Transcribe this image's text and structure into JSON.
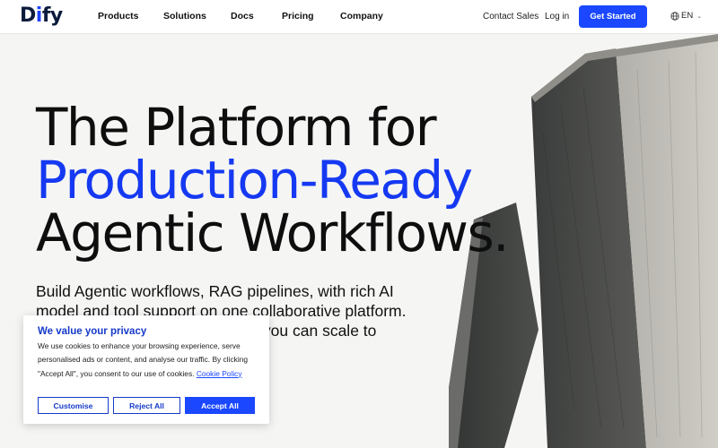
{
  "nav": {
    "logo_prefix": "D",
    "logo_mark": "i",
    "logo_suffix": "fy",
    "links": [
      "Products",
      "Solutions",
      "Docs",
      "Pricing",
      "Company"
    ],
    "contact": "Contact Sales",
    "login": "Log in",
    "cta": "Get Started",
    "lang": "EN"
  },
  "hero": {
    "line1": "The Platform for",
    "line2": "Production-Ready",
    "line3": "Agentic Workflows.",
    "subtitle": "Build Agentic workflows, RAG pipelines, with rich AI model and tool support on one collaborative platform. Cloud-hosted, or self-hosted, so you can scale to production without compromise."
  },
  "cookie": {
    "title": "We value your privacy",
    "body": "We use cookies to enhance your browsing experience, serve personalised ads or content, and analyse our traffic. By clicking \"Accept All\", you consent to our use of cookies.",
    "policy_link": "Cookie Policy",
    "customise": "Customise",
    "reject": "Reject All",
    "accept": "Accept All"
  },
  "colors": {
    "brand": "#1a47ff",
    "heading_blue": "#1539f2",
    "text": "#111111"
  }
}
